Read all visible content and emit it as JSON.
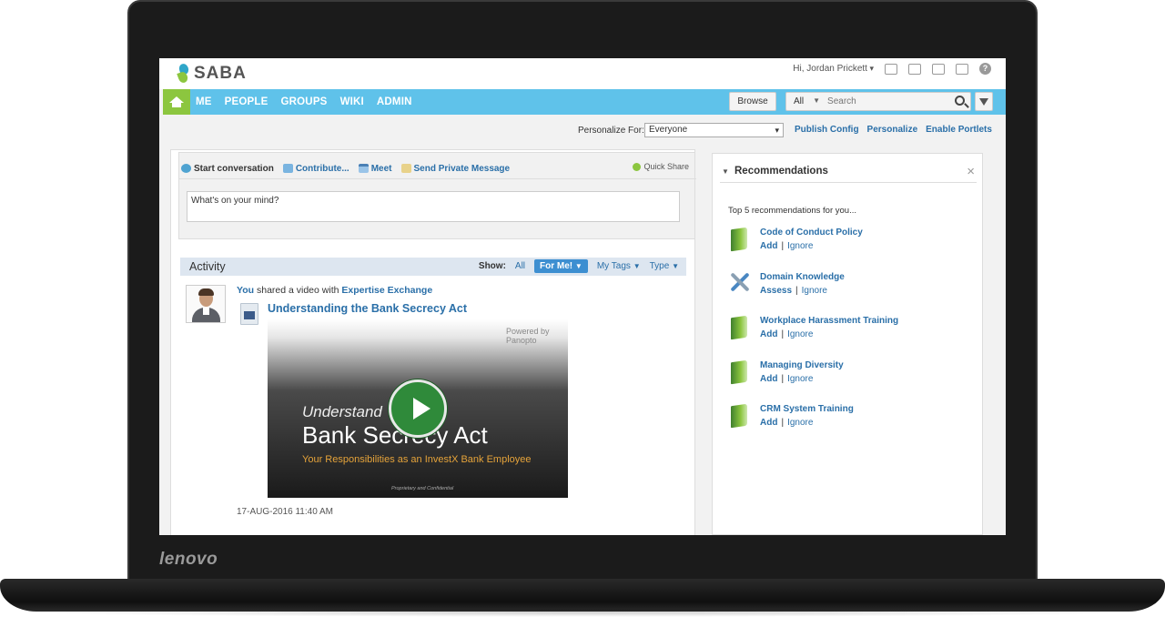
{
  "device": {
    "brand": "lenovo"
  },
  "header": {
    "logo_text": "SABA",
    "user_name": "Hi, Jordan Prickett",
    "icons": [
      "mail-icon",
      "profile-card-icon",
      "calendar-icon",
      "bookmark-icon",
      "help-icon"
    ],
    "help_glyph": "?"
  },
  "nav": {
    "items": [
      "ME",
      "PEOPLE",
      "GROUPS",
      "WIKI",
      "ADMIN"
    ],
    "browse_label": "Browse",
    "search_scope": "All",
    "search_placeholder": "Search"
  },
  "personalize": {
    "label": "Personalize For:",
    "value": "Everyone",
    "links": [
      "Publish Config",
      "Personalize",
      "Enable Portlets"
    ]
  },
  "composer": {
    "tabs": [
      "Start conversation",
      "Contribute...",
      "Meet",
      "Send Private Message"
    ],
    "quick_share": "Quick Share",
    "input_value": "What's on your mind?"
  },
  "activity": {
    "title": "Activity",
    "show_label": "Show:",
    "filters": {
      "all": "All",
      "for_me": "For Me!",
      "my_tags": "My Tags",
      "type": "Type"
    },
    "post": {
      "actor": "You",
      "action": "shared a video with",
      "target": "Expertise Exchange",
      "title": "Understanding the Bank Secrecy Act",
      "video": {
        "powered_by": "Powered by Panopto",
        "line1": "Understand",
        "line2": "Bank Secrecy Act",
        "line3": "Your Responsibilities as an InvestX Bank Employee",
        "footer": "Proprietary and Confidential"
      },
      "timestamp": "17-AUG-2016 11:40 AM"
    }
  },
  "recommendations": {
    "title": "Recommendations",
    "close_glyph": "×",
    "subtitle": "Top 5 recommendations for you...",
    "ignore_label": "Ignore",
    "items": [
      {
        "name": "Code of Conduct Policy",
        "action": "Add",
        "icon": "book-icon"
      },
      {
        "name": "Domain Knowledge",
        "action": "Assess",
        "icon": "tools-icon"
      },
      {
        "name": "Workplace Harassment Training",
        "action": "Add",
        "icon": "book-icon"
      },
      {
        "name": "Managing Diversity",
        "action": "Add",
        "icon": "book-icon"
      },
      {
        "name": "CRM System Training",
        "action": "Add",
        "icon": "book-icon"
      }
    ]
  }
}
